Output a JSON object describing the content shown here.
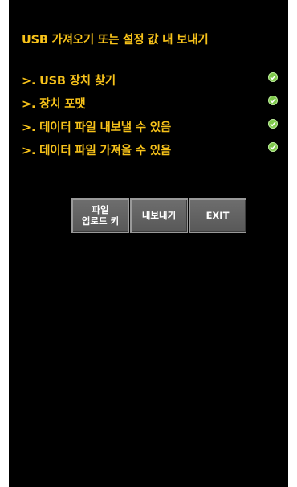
{
  "title": "USB 가져오기 또는 설정 값 내 보내기",
  "status_items": [
    {
      "label": ">. USB 장치 찾기",
      "icon": "check-circle-icon"
    },
    {
      "label": ">. 장치 포맷",
      "icon": "check-circle-icon"
    },
    {
      "label": ">. 데이터 파일 내보낼 수 있음",
      "icon": "check-circle-icon"
    },
    {
      "label": ">. 데이터 파일 가져올 수 있음",
      "icon": "check-circle-icon"
    }
  ],
  "buttons": {
    "upload_key": "파일\n업로드 키",
    "export": "내보내기",
    "exit": "EXIT"
  },
  "colors": {
    "text_accent": "#f7c21a",
    "screen_bg": "#000000",
    "check_green": "#7ec84a",
    "button_bg": "#606060"
  }
}
